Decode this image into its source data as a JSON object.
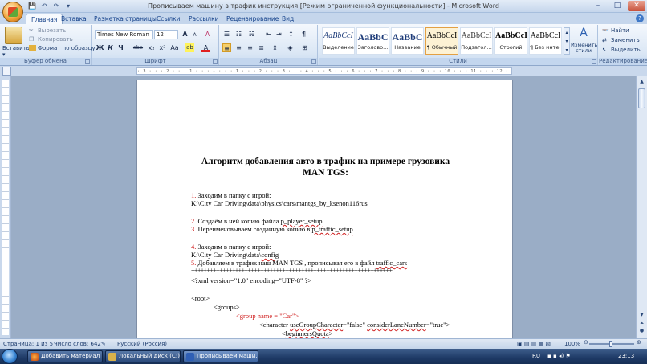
{
  "window": {
    "title": "Прописываем машину в трафик инструкция [Режим ограниченной функциональности] - Microsoft Word",
    "controls": {
      "minimize": "–",
      "maximize": "□",
      "close": "✕"
    }
  },
  "qat": {
    "save": "💾",
    "undo": "↶",
    "redo": "↷",
    "more": "▾"
  },
  "tabs": [
    "Главная",
    "Вставка",
    "Разметка страницы",
    "Ссылки",
    "Рассылки",
    "Рецензирование",
    "Вид"
  ],
  "ribbon": {
    "clipboard": {
      "label": "Буфер обмена",
      "paste": "Вставить",
      "cut": "Вырезать",
      "copy": "Копировать",
      "format_painter": "Формат по образцу"
    },
    "font": {
      "label": "Шрифт",
      "font_name": "Times New Roman",
      "font_size": "12",
      "bold": "Ж",
      "italic": "К",
      "underline": "Ч",
      "strike": "abe",
      "sub": "x₂",
      "sup": "x²",
      "case": "Aa",
      "grow": "A",
      "shrink": "A",
      "clear": "A",
      "highlight": "ab",
      "color": "A"
    },
    "paragraph": {
      "label": "Абзац",
      "pilcrow": "¶"
    },
    "styles": {
      "label": "Стили",
      "items": [
        {
          "sample": "AaBbCcI",
          "name": "Выделение"
        },
        {
          "sample": "AaBbC",
          "name": "Заголово..."
        },
        {
          "sample": "AaBbC",
          "name": "Название"
        },
        {
          "sample": "AaBbCcI",
          "name": "¶ Обычный"
        },
        {
          "sample": "AaBbCcI",
          "name": "Подзагол..."
        },
        {
          "sample": "AaBbCcI",
          "name": "Строгий"
        },
        {
          "sample": "AaBbCcI",
          "name": "¶ Без инте..."
        }
      ],
      "change_styles": "Изменить стили"
    },
    "editing": {
      "label": "Редактирование",
      "find": "Найти",
      "replace": "Заменить",
      "select": "Выделить"
    }
  },
  "ruler": {
    "text": "· 3 · · · 2 · · · 1 · · · ▵ · · · 1 · · · 2 · · · 3 · · · 4 · · · 5 · · · 6 · · · 7 · · · 8 · · · 9 · · · 10 · · · 11 · · · 12 · · · 13 · · · 14 · · · 15 · · · 16 · ▵ · 17 ·"
  },
  "document": {
    "title_line1": "Алгоритм добавления авто в трафик  на примере грузовика",
    "title_line2": "MAN TGS:",
    "step1_num": "1.",
    "step1_text": " Заходим в папку с игрой:",
    "path1": "K:\\City Car Driving\\data\\physics\\cars\\mantgs_by_ksenon116rus",
    "step2_num": "2.",
    "step2_text": " Создаём в ней копию файла ",
    "step2_file": "p_player_setup",
    "step3_num": "3.",
    "step3_text": " Переименовываем созданную копию в ",
    "step3_file": "p_traffic_setup",
    "step4_num": "4.",
    "step4_text": " Заходим в папку с игрой:",
    "path2_prefix": "K:\\City Car Driving\\data\\",
    "path2_folder": "config",
    "step5_num": "5.",
    "step5_text": " Добавляем в трафик наш MAN TGS , прописывая его в файл ",
    "step5_file": "traffic_cars",
    "separator": "++++++++++++++++++++++++++++++++++++++++++++++++++++++++++++++++",
    "xml_decl": "<?xml version=\"1.0\"  encoding=\"UTF-8\"  ?>",
    "root": "<root>",
    "groups": "<groups>",
    "group_name": "<group name = \"Car\">",
    "character_prefix": "<character ",
    "character_attr1": "useGroupCharacter",
    "character_mid": "=\"false\"  ",
    "character_attr2": "considerLaneNumber",
    "character_suffix": "=\"true\">",
    "beginners": "beginnersQuota",
    "beginners_open": "<",
    "beginners_close": ">"
  },
  "status": {
    "page": "Страница: 1 из 5",
    "words": "Число слов: 642",
    "language": "Русский (Россия)",
    "zoom": "100%"
  },
  "taskbar": {
    "tasks": [
      "Добавить материал ...",
      "Локальный диск (C:)",
      "Прописываем маши..."
    ],
    "lang": "RU",
    "clock": "23:13"
  }
}
